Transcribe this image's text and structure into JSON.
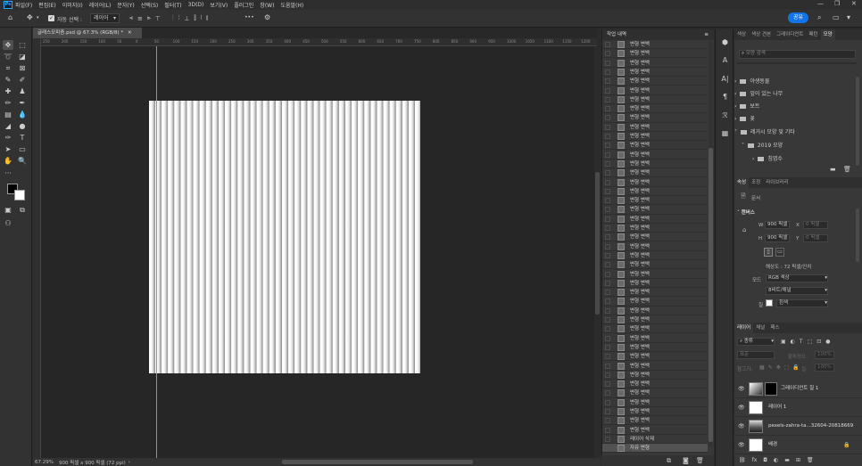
{
  "app": {
    "logo": "Ps"
  },
  "menus": [
    "파일(F)",
    "편집(E)",
    "이미지(I)",
    "레이어(L)",
    "문자(Y)",
    "선택(S)",
    "필터(T)",
    "3D(D)",
    "보기(V)",
    "플러그인",
    "창(W)",
    "도움말(H)"
  ],
  "options": {
    "auto_select_label": "자동 선택 :",
    "auto_select_value": "레이어",
    "more": "•••",
    "share": "공유"
  },
  "document": {
    "tab_title": "글래스모피즘.psd @ 67.3% (RGB/8) *",
    "ruler_marks": [
      "250",
      "200",
      "150",
      "100",
      "50",
      "0",
      "50",
      "100",
      "150",
      "200",
      "250",
      "300",
      "350",
      "400",
      "450",
      "500",
      "550",
      "600",
      "650",
      "700",
      "750",
      "800",
      "850",
      "900",
      "950",
      "1000",
      "1050",
      "1100",
      "1150",
      "1200"
    ],
    "zoom": "67.29%",
    "doc_info": "900 픽셀 x 900 픽셀 (72 ppi)"
  },
  "history": {
    "tab": "작업 내역",
    "items": [
      "변형 변백",
      "변형 변백",
      "변형 변백",
      "변형 변백",
      "변형 변백",
      "변형 변백",
      "변형 변백",
      "변형 변백",
      "변형 변백",
      "변형 변백",
      "변형 변백",
      "변형 변백",
      "변형 변백",
      "변형 변백",
      "변형 변백",
      "변형 변백",
      "변형 변백",
      "변형 변백",
      "변형 변백",
      "변형 변백",
      "변형 변백",
      "변형 변백",
      "변형 변백",
      "변형 변백",
      "변형 변백",
      "변형 변백",
      "변형 변백",
      "변형 변백",
      "변형 변백",
      "변형 변백",
      "변형 변백",
      "변형 변백",
      "변형 변백",
      "변형 변백",
      "변형 변백",
      "변형 변백",
      "변형 변백",
      "변형 변백",
      "변형 변백",
      "변형 변백",
      "변형 변백",
      "변형 변백",
      "변형 변백",
      "레이어 삭제",
      "자유 변형"
    ]
  },
  "shapes_panel": {
    "tabs": [
      "색상",
      "색상 견본",
      "그레이디언트",
      "패턴",
      "모양"
    ],
    "search_placeholder": "모양 검색",
    "groups": [
      "야생동물",
      "잎이 있는 나무",
      "보트",
      "꽃",
      "레거시 모양 및 기타",
      "2019 모양",
      "침엽수"
    ]
  },
  "properties": {
    "tabs": [
      "속성",
      "조정",
      "라이브러리"
    ],
    "doc_label": "문서",
    "section": "캔버스",
    "w_label": "W",
    "w_value": "900 픽셀",
    "h_label": "H",
    "h_value": "900 픽셀",
    "x_label": "X",
    "x_value": "0 픽셀",
    "y_label": "Y",
    "y_value": "0 픽셀",
    "resolution": "해상도 : 72 픽셀/인치",
    "mode_label": "모드",
    "mode_value": "RGB 색상",
    "bits_value": "8비트/채널",
    "fill_label": "칠",
    "fill_value": "흰색"
  },
  "layers_panel": {
    "tabs": [
      "레이어",
      "채널",
      "패스"
    ],
    "filter_label": "종류",
    "blend_mode": "표준",
    "opacity_label": "불투명도:",
    "opacity_value": "100%",
    "lock_label": "잠그기:",
    "fill_label": "칠:",
    "fill_value": "100%",
    "layers": [
      "그레이디언트 칠 1",
      "레이어 1",
      "pexels-zahra-ta...32604-20818669",
      "배경"
    ]
  }
}
